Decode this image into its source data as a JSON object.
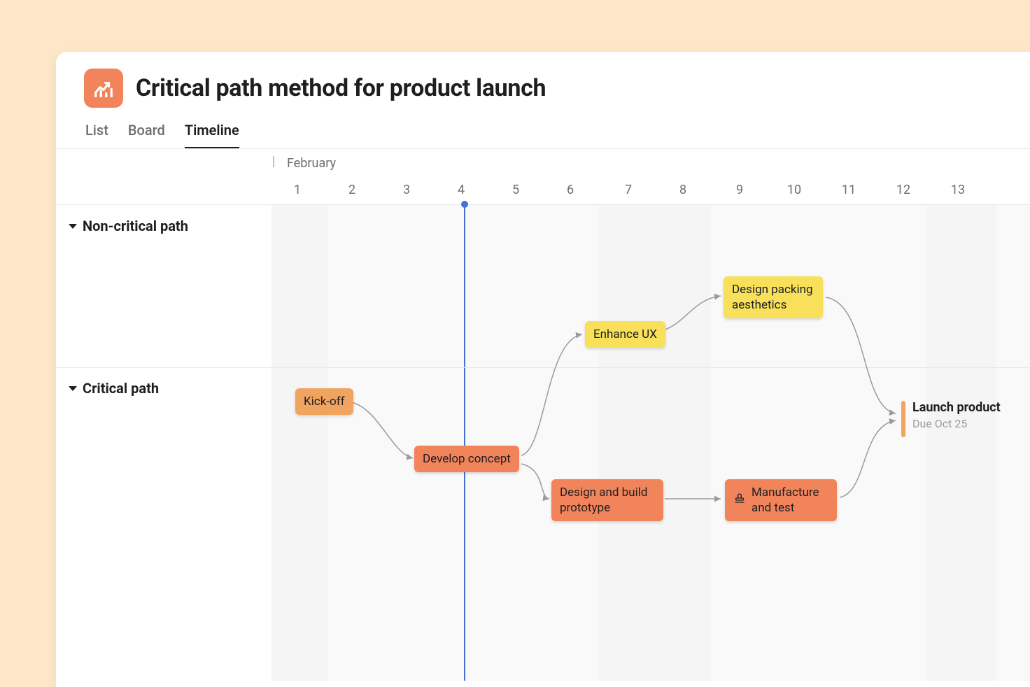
{
  "header": {
    "title": "Critical path method for product launch",
    "icon": "chart-up-icon"
  },
  "tabs": [
    {
      "label": "List",
      "active": false
    },
    {
      "label": "Board",
      "active": false
    },
    {
      "label": "Timeline",
      "active": true
    }
  ],
  "timeline": {
    "month_label": "February",
    "days": [
      "1",
      "2",
      "3",
      "4",
      "5",
      "6",
      "7",
      "8",
      "9",
      "10",
      "11",
      "12",
      "13"
    ],
    "today_index": 3
  },
  "sections": [
    {
      "name": "Non-critical path"
    },
    {
      "name": "Critical path"
    }
  ],
  "tasks": {
    "kickoff": {
      "label": "Kick-off",
      "color": "orange"
    },
    "develop": {
      "label": "Develop concept",
      "color": "salmon"
    },
    "enhance": {
      "label": "Enhance UX",
      "color": "yellow"
    },
    "packing": {
      "label": "Design packing aesthetics",
      "color": "yellow"
    },
    "prototype": {
      "label": "Design and build prototype",
      "color": "salmon"
    },
    "manufacture": {
      "label": "Manufacture and test",
      "color": "salmon",
      "icon": "stamp-icon"
    }
  },
  "milestone": {
    "title": "Launch product",
    "due": "Due Oct 25"
  },
  "colors": {
    "orange": "#f1a360",
    "salmon": "#f2845c",
    "yellow": "#f8e05b",
    "today": "#4573d2"
  }
}
